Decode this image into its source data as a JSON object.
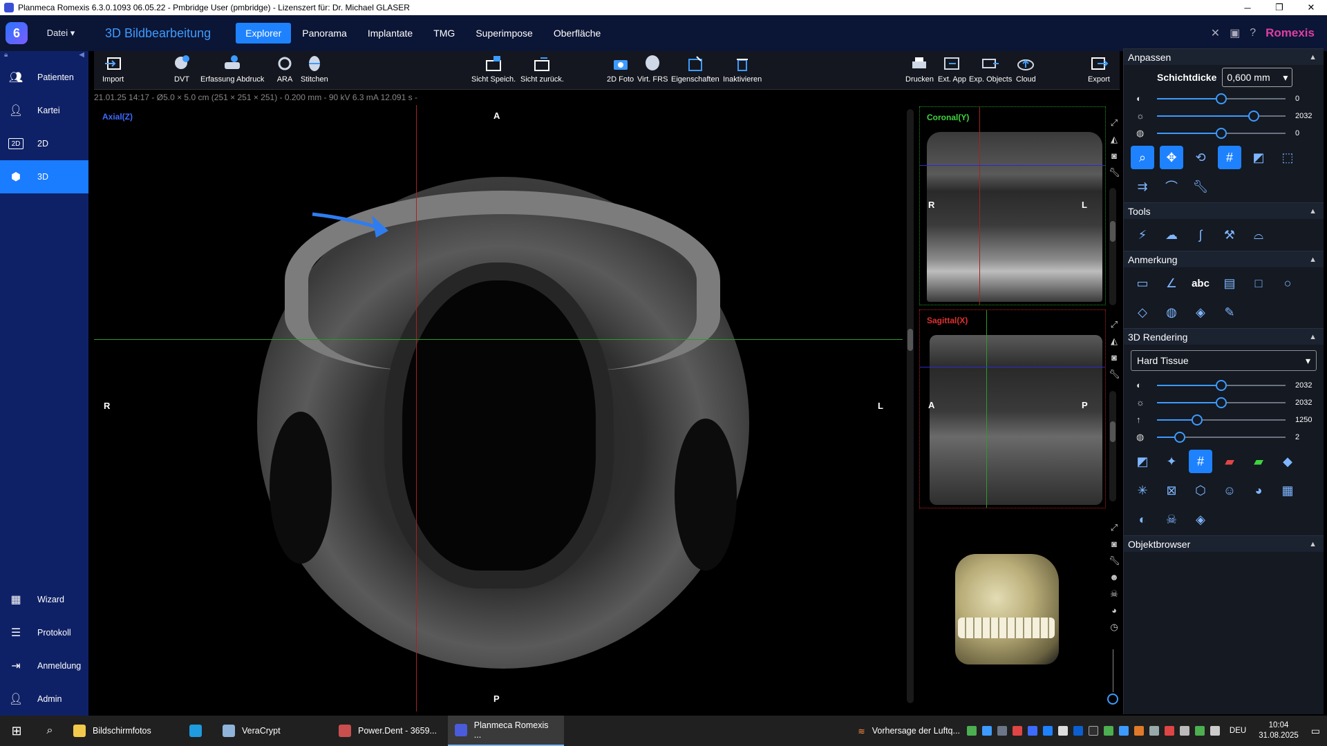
{
  "titlebar": {
    "title": "Planmeca Romexis 6.3.0.1093 06.05.22 - Pmbridge User (pmbridge) - Lizenszert für: Dr. Michael GLASER",
    "minimize": "─",
    "maximize": "❐",
    "close": "✕"
  },
  "menubar": {
    "datei": "Datei",
    "mode_title": "3D Bildbearbeitung",
    "tabs": [
      "Explorer",
      "Panorama",
      "Implantate",
      "TMG",
      "Superimpose",
      "Oberfläche"
    ],
    "brand": "Romexis"
  },
  "sidebar": {
    "items": [
      {
        "label": "Patienten",
        "icon": "patients-icon"
      },
      {
        "label": "Kartei",
        "icon": "person-icon"
      },
      {
        "label": "2D",
        "icon": "2d-icon"
      },
      {
        "label": "3D",
        "icon": "3d-cube-icon"
      }
    ],
    "bottom": [
      {
        "label": "Wizard",
        "icon": "wizard-icon"
      },
      {
        "label": "Protokoll",
        "icon": "protocol-icon"
      },
      {
        "label": "Anmeldung",
        "icon": "login-icon"
      },
      {
        "label": "Admin",
        "icon": "admin-icon"
      }
    ]
  },
  "toolbar": {
    "import": "Import",
    "dvt": "DVT",
    "erfassung": "Erfassung Abdruck",
    "ara": "ARA",
    "stitchen": "Stitchen",
    "sicht_speich": "Sicht Speich.",
    "sicht_zurueck": "Sicht zurück.",
    "foto2d": "2D Foto",
    "virt_frs": "Virt. FRS",
    "eigenschaften": "Eigenschaften",
    "inaktivieren": "Inaktivieren",
    "drucken": "Drucken",
    "ext_app": "Ext. App",
    "exp_objects": "Exp. Objects",
    "cloud": "Cloud",
    "export": "Export"
  },
  "info": "21.01.25 14:17 - Ø5.0 × 5.0 cm (251 × 251 × 251) - 0.200 mm - 90 kV 6.3 mA 12.091 s -",
  "axial": {
    "label": "Axial(Z)",
    "top": "A",
    "bottom": "P",
    "left": "R",
    "right": "L"
  },
  "coronal": {
    "label": "Coronal(Y)",
    "left": "R",
    "right": "L"
  },
  "sagittal": {
    "label": "Sagittal(X)",
    "left": "A",
    "right": "P"
  },
  "panel": {
    "anpassen": "Anpassen",
    "schichtdicke_label": "Schichtdicke",
    "schichtdicke_value": "0,600 mm",
    "sliders": [
      {
        "icon": "contrast-icon",
        "value": "0",
        "fraction": 0.5
      },
      {
        "icon": "brightness-icon",
        "value": "2032",
        "fraction": 0.75
      },
      {
        "icon": "sharpness-icon",
        "value": "0",
        "fraction": 0.5
      }
    ],
    "tools": "Tools",
    "anmerkung": "Anmerkung",
    "rendering": "3D Rendering",
    "rendering_preset": "Hard Tissue",
    "render_sliders": [
      {
        "icon": "contrast-icon",
        "value": "2032",
        "fraction": 0.5
      },
      {
        "icon": "brightness-icon",
        "value": "2032",
        "fraction": 0.5
      },
      {
        "icon": "arrow-up-icon",
        "value": "1250",
        "fraction": 0.31
      },
      {
        "icon": "sharpness-icon",
        "value": "2",
        "fraction": 0.18
      }
    ],
    "objektbrowser": "Objektbrowser",
    "abc": "abc"
  },
  "taskbar": {
    "apps": [
      {
        "label": "Bildschirmfotos",
        "color": "#f2c94c"
      },
      {
        "label": "",
        "color": "#1f9be0"
      },
      {
        "label": "VeraCrypt",
        "color": "#8fb3d9"
      },
      {
        "label": "Power.Dent  -  3659...",
        "color": "#c94f4f"
      },
      {
        "label": "Planmeca Romexis ...",
        "color": "#4a5bdc"
      }
    ],
    "weather": "Vorhersage der Luftq...",
    "lang": "DEU",
    "time": "10:04",
    "date": "31.08.2025"
  }
}
